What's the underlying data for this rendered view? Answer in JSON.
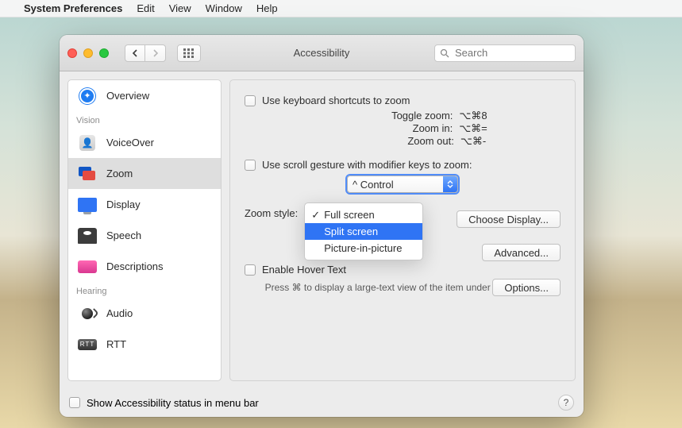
{
  "menubar": {
    "app": "System Preferences",
    "items": [
      "Edit",
      "View",
      "Window",
      "Help"
    ]
  },
  "window": {
    "title": "Accessibility",
    "search_placeholder": "Search"
  },
  "sidebar": {
    "headings": {
      "vision": "Vision",
      "hearing": "Hearing"
    },
    "items": {
      "overview": "Overview",
      "voiceover": "VoiceOver",
      "zoom": "Zoom",
      "display": "Display",
      "speech": "Speech",
      "descriptions": "Descriptions",
      "audio": "Audio",
      "rtt": "RTT"
    }
  },
  "main": {
    "use_shortcuts": "Use keyboard shortcuts to zoom",
    "shortcuts": {
      "toggle_label": "Toggle zoom:",
      "toggle_keys": "⌥⌘8",
      "in_label": "Zoom in:",
      "in_keys": "⌥⌘=",
      "out_label": "Zoom out:",
      "out_keys": "⌥⌘-"
    },
    "use_scroll": "Use scroll gesture with modifier keys to zoom:",
    "modifier_value": "^ Control",
    "zoom_style_label": "Zoom style:",
    "zoom_style_options": {
      "full": "Full screen",
      "split": "Split screen",
      "pip": "Picture-in-picture"
    },
    "choose_display": "Choose Display...",
    "advanced": "Advanced...",
    "enable_hover": "Enable Hover Text",
    "options": "Options...",
    "hover_hint": "Press ⌘ to display a large-text view of the item under the pointer."
  },
  "footer": {
    "show_status": "Show Accessibility status in menu bar"
  }
}
